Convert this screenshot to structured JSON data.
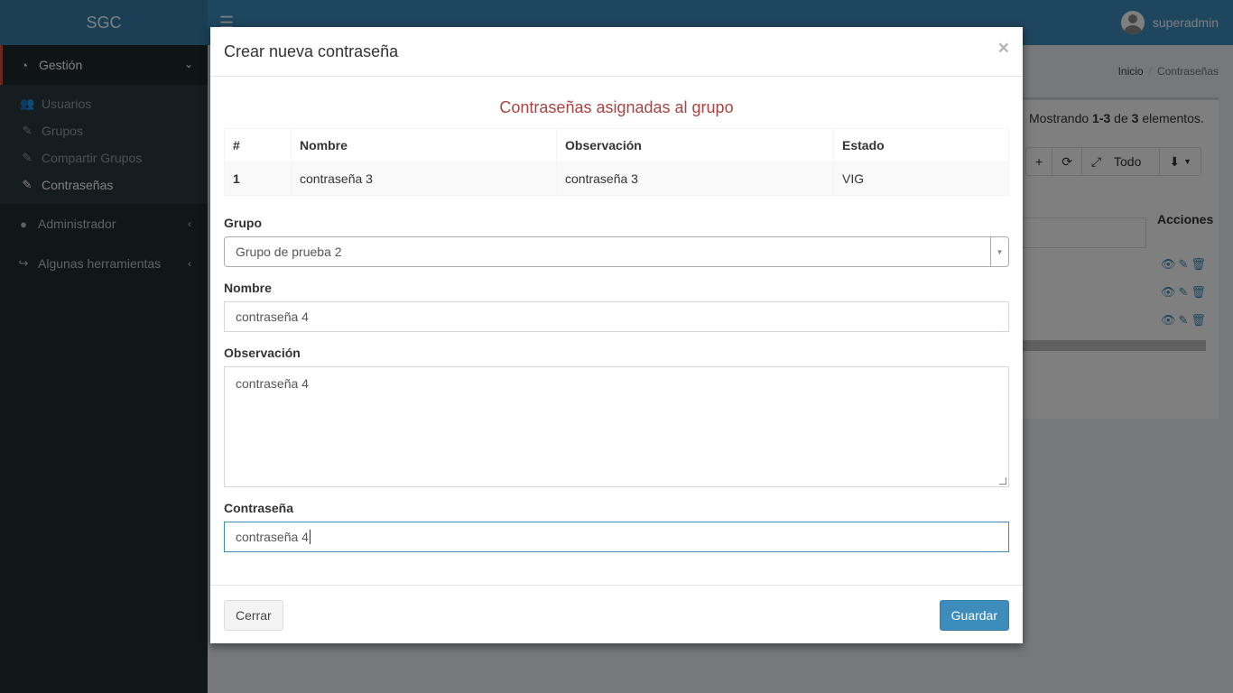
{
  "app": {
    "brand": "SGC",
    "menu_icon": "hamburger-icon",
    "user_name": "superadmin",
    "colors": {
      "header": "#3c8dbc",
      "sidebar": "#222d32",
      "accent": "#dd4b39",
      "primary": "#3c8dbc"
    }
  },
  "sidebar": {
    "header": {
      "label": "Gestión",
      "icon": "dashboard-icon"
    },
    "subitems": [
      {
        "label": "Usuarios",
        "icon": "users-icon"
      },
      {
        "label": "Grupos",
        "icon": "edit-icon"
      },
      {
        "label": "Compartir Grupos",
        "icon": "edit-icon"
      },
      {
        "label": "Contraseñas",
        "icon": "edit-icon"
      }
    ],
    "items": [
      {
        "label": "Administrador",
        "icon": "user-circle-icon"
      },
      {
        "label": "Algunas herramientas",
        "icon": "share-icon"
      }
    ]
  },
  "background": {
    "breadcrumb": {
      "home": "Inicio",
      "current": "Contraseñas"
    },
    "showing": {
      "prefix": "Mostrando ",
      "range": "1-3",
      "middle": " de ",
      "total": "3",
      "suffix": " elementos."
    },
    "toolbar": {
      "add": "+",
      "refresh": "⟳",
      "all": "Todo",
      "export": "▼"
    },
    "actions_header": "Acciones"
  },
  "modal": {
    "title": "Crear nueva contraseña",
    "close": "×",
    "section_title": "Contraseñas asignadas al grupo",
    "table": {
      "headers": [
        "#",
        "Nombre",
        "Observación",
        "Estado"
      ],
      "rows": [
        [
          "1",
          "contraseña 3",
          "contraseña 3",
          "VIG"
        ]
      ]
    },
    "form": {
      "group_label": "Grupo",
      "group_value": "Grupo de prueba 2",
      "name_label": "Nombre",
      "name_value": "contraseña 4",
      "obs_label": "Observación",
      "obs_value": "contraseña 4",
      "password_label": "Contraseña",
      "password_value": "contraseña 4"
    },
    "buttons": {
      "close": "Cerrar",
      "save": "Guardar"
    }
  }
}
